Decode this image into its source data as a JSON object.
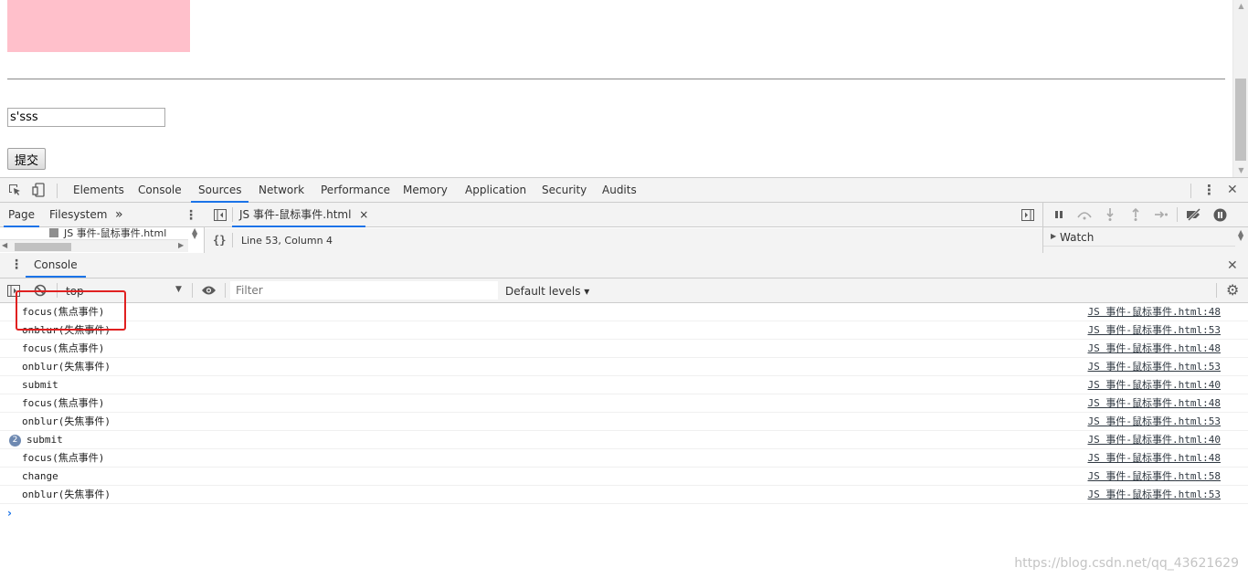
{
  "page": {
    "input_value": "s'sss",
    "submit_label": "提交"
  },
  "devtools": {
    "main_tabs": [
      "Elements",
      "Console",
      "Sources",
      "Network",
      "Performance",
      "Memory",
      "Application",
      "Security",
      "Audits"
    ],
    "active_main_tab": "Sources",
    "navigator": {
      "tabs": [
        "Page",
        "Filesystem"
      ],
      "more_label": "»",
      "file": "JS 事件-鼠标事件.html"
    },
    "editor": {
      "open_file": "JS 事件-鼠标事件.html",
      "close_glyph": "×",
      "format_glyph": "{}",
      "cursor_position": "Line 53, Column 4"
    },
    "debugger": {
      "watch_label": "Watch"
    },
    "drawer": {
      "tab": "Console",
      "close_glyph": "✕"
    },
    "console_toolbar": {
      "context": "top",
      "filter_placeholder": "Filter",
      "levels": "Default levels ▾"
    },
    "messages": [
      {
        "text": "focus(焦点事件)",
        "source": "JS 事件-鼠标事件.html:48"
      },
      {
        "text": "onblur(失焦事件)",
        "source": "JS 事件-鼠标事件.html:53"
      },
      {
        "text": "focus(焦点事件)",
        "source": "JS 事件-鼠标事件.html:48"
      },
      {
        "text": "onblur(失焦事件)",
        "source": "JS 事件-鼠标事件.html:53"
      },
      {
        "text": "submit",
        "source": "JS 事件-鼠标事件.html:40"
      },
      {
        "text": "focus(焦点事件)",
        "source": "JS 事件-鼠标事件.html:48"
      },
      {
        "text": "onblur(失焦事件)",
        "source": "JS 事件-鼠标事件.html:53"
      },
      {
        "text": "submit",
        "count": "2",
        "source": "JS 事件-鼠标事件.html:40"
      },
      {
        "text": "focus(焦点事件)",
        "source": "JS 事件-鼠标事件.html:48"
      },
      {
        "text": "change",
        "source": "JS 事件-鼠标事件.html:58"
      },
      {
        "text": "onblur(失焦事件)",
        "source": "JS 事件-鼠标事件.html:53"
      }
    ],
    "prompt_glyph": "›"
  },
  "watermark": "https://blog.csdn.net/qq_43621629",
  "colors": {
    "pink_box": "#ffc0cb",
    "accent": "#1a73e8",
    "highlight": "#e02020"
  }
}
